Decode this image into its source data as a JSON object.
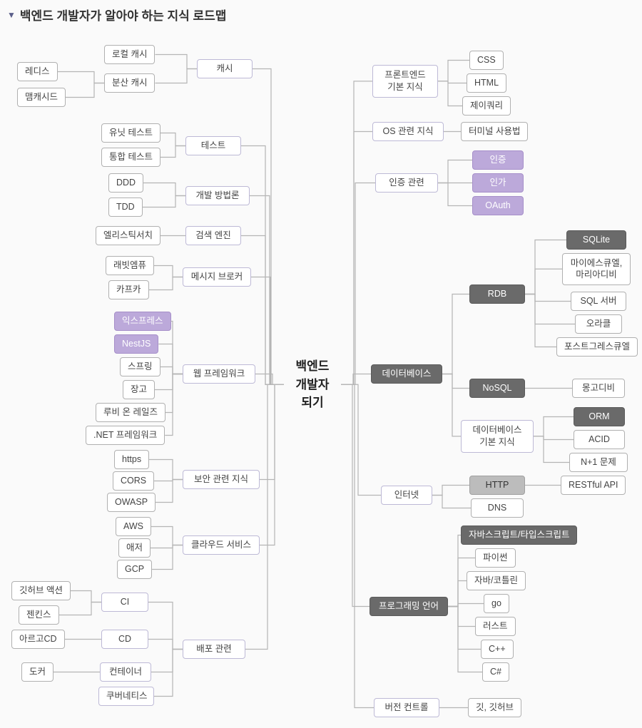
{
  "title": "백엔드 개발자가 알아야 하는 지식 로드맵",
  "center": "백엔드\n개발자\n되기",
  "L_cache": "캐시",
  "L_cache_local": "로컬 캐시",
  "L_cache_dist": "분산 캐시",
  "L_redis": "레디스",
  "L_memcached": "맴캐시드",
  "L_test": "테스트",
  "L_unit": "유닛 테스트",
  "L_integ": "통합 테스트",
  "L_method": "개발 방법론",
  "L_ddd": "DDD",
  "L_tdd": "TDD",
  "L_search": "검색 엔진",
  "L_elastic": "엘리스틱서치",
  "L_mq": "메시지 브로커",
  "L_rabbit": "래빗엠퓨",
  "L_kafka": "카프카",
  "L_web": "웹 프레임워크",
  "L_express": "익스프레스",
  "L_nest": "NestJS",
  "L_spring": "스프링",
  "L_django": "장고",
  "L_ror": "루비 온 레일즈",
  "L_dotnet": ".NET 프레임워크",
  "L_sec": "보안 관련 지식",
  "L_https": "https",
  "L_cors": "CORS",
  "L_owasp": "OWASP",
  "L_cloud": "클라우드 서비스",
  "L_aws": "AWS",
  "L_azure": "애저",
  "L_gcp": "GCP",
  "L_deploy": "배포 관련",
  "L_ci": "CI",
  "L_cd": "CD",
  "L_container": "컨테이너",
  "L_k8s": "쿠버네티스",
  "L_gha": "깃허브 액션",
  "L_jenkins": "젠킨스",
  "L_argo": "아르고CD",
  "L_docker": "도커",
  "R_fe": "프론트엔드\n기본 지식",
  "R_css": "CSS",
  "R_html": "HTML",
  "R_jq": "제이쿼리",
  "R_os": "OS 관련 지식",
  "R_term": "터미널 사용법",
  "R_auth": "인증 관련",
  "R_authn": "인증",
  "R_authz": "인가",
  "R_oauth": "OAuth",
  "R_db": "데이터베이스",
  "R_rdb": "RDB",
  "R_sqlite": "SQLite",
  "R_mysql": "마이에스큐엘,\n마리아디비",
  "R_mssql": "SQL 서버",
  "R_oracle": "오라클",
  "R_postgres": "포스트그레스큐엘",
  "R_nosql": "NoSQL",
  "R_mongo": "몽고디비",
  "R_dbbasic": "데이터베이스\n기본 지식",
  "R_orm": "ORM",
  "R_acid": "ACID",
  "R_n1": "N+1 문제",
  "R_inet": "인터넷",
  "R_http": "HTTP",
  "R_dns": "DNS",
  "R_rest": "RESTful API",
  "R_lang": "프로그래밍 언어",
  "R_jsts": "자바스크립트/타입스크립트",
  "R_py": "파이썬",
  "R_java": "자바/코틀린",
  "R_go": "go",
  "R_rust": "러스트",
  "R_cpp": "C++",
  "R_cs": "C#",
  "R_vcs": "버전 컨트롤",
  "R_git": "깃, 깃허브"
}
